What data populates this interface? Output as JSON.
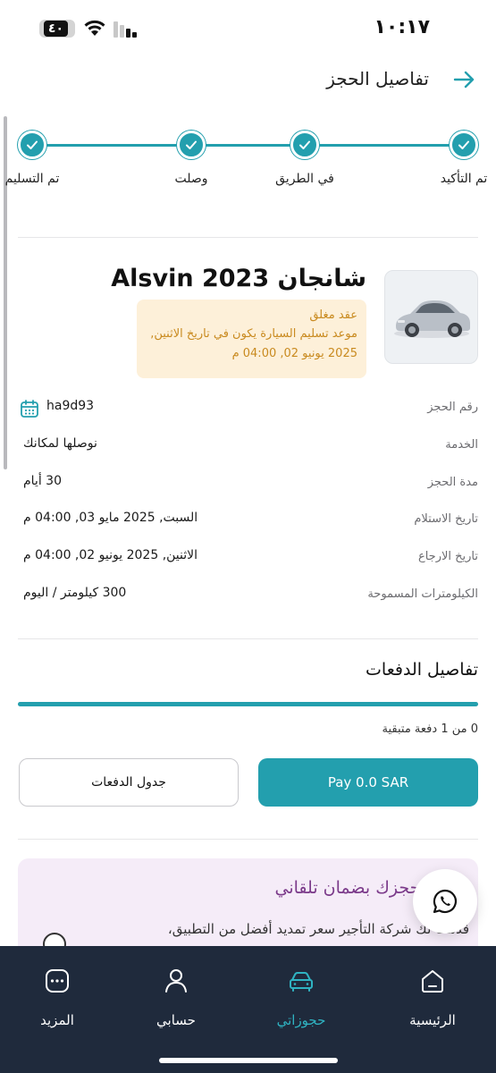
{
  "status_bar": {
    "time": "١٠:١٧",
    "battery_level": "٤٠"
  },
  "header": {
    "title": "تفاصيل الحجز",
    "back_icon": "arrow-right-icon"
  },
  "stepper": {
    "steps": [
      {
        "label": "تم التأكيد",
        "done": true
      },
      {
        "label": "في الطريق",
        "done": true
      },
      {
        "label": "وصلت",
        "done": true
      },
      {
        "label": "تم التسليم",
        "done": true
      }
    ]
  },
  "car": {
    "name": "شانجان Alsvin 2023",
    "status_title": "عقد مغلق",
    "status_text": "موعد تسليم السيارة يكون في تاريخ الاثنين, 2025 يونيو 02, 04:00 م"
  },
  "details": {
    "booking_number": {
      "label": "رقم الحجز",
      "value": "ha9d93"
    },
    "service": {
      "label": "الخدمة",
      "value": "نوصلها لمكانك"
    },
    "duration": {
      "label": "مدة الحجز",
      "value": "30 أيام"
    },
    "pickup_date": {
      "label": "تاريخ الاستلام",
      "value": "السبت, 2025 مايو 03, 04:00 م"
    },
    "return_date": {
      "label": "تاريخ الارجاع",
      "value": "الاثنين, 2025 يونيو 02, 04:00 م"
    },
    "allowed_km": {
      "label": "الكيلومترات المسموحة",
      "value": "300 كيلومتر / اليوم"
    }
  },
  "payments": {
    "title": "تفاصيل الدفعات",
    "progress_fraction": 1.0,
    "remaining_text": "0 من 1 دفعة متبقية",
    "pay_button": "Pay 0.0 SAR",
    "schedule_button": "جدول الدفعات"
  },
  "extension": {
    "title": "مدد حجزك بضمان تلقاني",
    "text": "قدمت لك شركة التأجير سعر تمديد أفضل من التطبيق،"
  },
  "bottom_nav": {
    "items": [
      {
        "label": "الرئيسية",
        "icon": "home-icon"
      },
      {
        "label": "حجوزاتي",
        "icon": "car-icon",
        "active": true
      },
      {
        "label": "حسابي",
        "icon": "user-icon"
      },
      {
        "label": "المزيد",
        "icon": "more-icon"
      }
    ]
  },
  "colors": {
    "accent": "#239fae",
    "nav_background": "#1f2a3c",
    "warning_background": "#fdf0d9",
    "warning_text": "#c98a1f",
    "promo_background": "#f5ecf8",
    "promo_title": "#7b3a8a"
  }
}
